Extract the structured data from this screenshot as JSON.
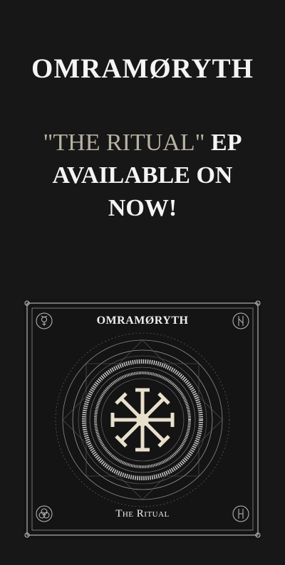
{
  "header": {
    "band_name": "OMRAMØRYTH"
  },
  "announcement": {
    "release_title": "\"THE RITUAL\"",
    "release_type": "EP",
    "line2": "AVAILABLE ON",
    "line3": "NOW!"
  },
  "cover": {
    "band_name": "OMRAMØRYTH",
    "album_title": "The Ritual",
    "corner_icons": [
      "mercury-symbol-icon",
      "rune-glyph-icon",
      "triquetra-icon",
      "rune-glyph-icon"
    ],
    "center_icon": "solar-wheel-sigil-icon"
  },
  "colors": {
    "background": "#171717",
    "text": "#f4f4f4",
    "quoted_text": "#b8b2a3",
    "sigil": "#e8e0cc"
  }
}
